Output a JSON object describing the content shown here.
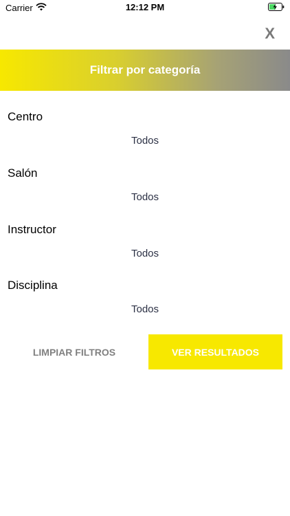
{
  "status_bar": {
    "carrier": "Carrier",
    "time": "12:12 PM"
  },
  "close_label": "X",
  "header": {
    "title": "Filtrar por categoría"
  },
  "filters": [
    {
      "label": "Centro",
      "value": "Todos"
    },
    {
      "label": "Salón",
      "value": "Todos"
    },
    {
      "label": "Instructor",
      "value": "Todos"
    },
    {
      "label": "Disciplina",
      "value": "Todos"
    }
  ],
  "actions": {
    "clear_label": "LIMPIAR FILTROS",
    "results_label": "VER RESULTADOS"
  },
  "colors": {
    "accent": "#f7e800",
    "header_gradient_end": "#8a8a8a",
    "value_text": "#2b3044",
    "clear_text": "#808080"
  },
  "icons": {
    "wifi": "wifi-icon",
    "battery": "battery-charging-icon"
  }
}
